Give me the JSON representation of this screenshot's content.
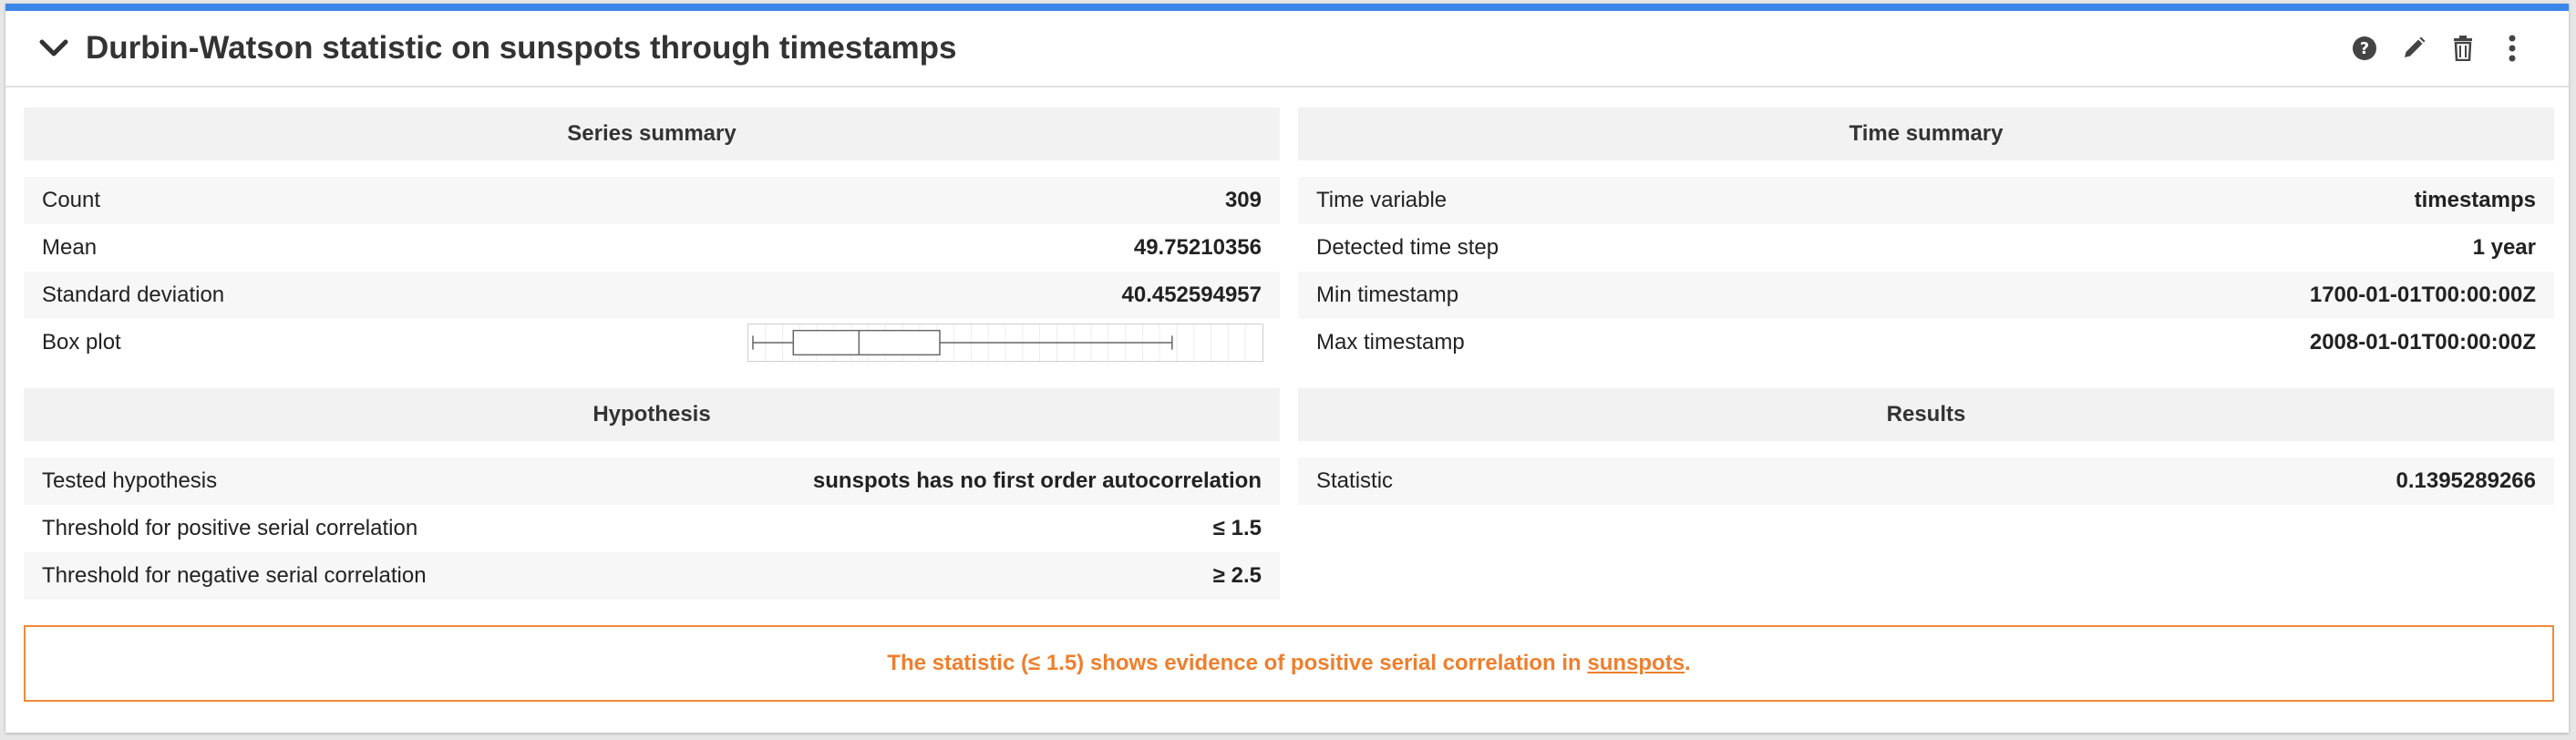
{
  "header": {
    "title": "Durbin-Watson statistic on sunspots through timestamps",
    "icons": [
      "chevron-down-icon",
      "help-icon",
      "pencil-icon",
      "trash-icon",
      "more-vertical-icon"
    ]
  },
  "series_summary": {
    "title": "Series summary",
    "count": {
      "label": "Count",
      "value": "309"
    },
    "mean": {
      "label": "Mean",
      "value": "49.75210356"
    },
    "std": {
      "label": "Standard deviation",
      "value": "40.452594957"
    },
    "boxplot": {
      "label": "Box plot",
      "min_frac": 0.0,
      "q1_frac": 0.08,
      "median_frac": 0.21,
      "q3_frac": 0.37,
      "max_frac": 0.83
    }
  },
  "time_summary": {
    "title": "Time summary",
    "time_variable": {
      "label": "Time variable",
      "value": "timestamps"
    },
    "time_step": {
      "label": "Detected time step",
      "value": "1 year"
    },
    "min_ts": {
      "label": "Min timestamp",
      "value": "1700-01-01T00:00:00Z"
    },
    "max_ts": {
      "label": "Max timestamp",
      "value": "2008-01-01T00:00:00Z"
    }
  },
  "hypothesis": {
    "title": "Hypothesis",
    "tested": {
      "label": "Tested hypothesis",
      "value": "sunspots has no first order autocorrelation"
    },
    "pos_threshold": {
      "label": "Threshold for positive serial correlation",
      "value": "≤ 1.5"
    },
    "neg_threshold": {
      "label": "Threshold for negative serial correlation",
      "value": "≥ 2.5"
    }
  },
  "results": {
    "title": "Results",
    "statistic": {
      "label": "Statistic",
      "value": "0.1395289266"
    }
  },
  "alert": {
    "prefix": "The statistic (≤ 1.5) shows evidence of positive serial correlation in ",
    "link": "sunspots",
    "suffix": "."
  },
  "colors": {
    "accent": "#3b86e8",
    "warning": "#ee7f2d"
  }
}
